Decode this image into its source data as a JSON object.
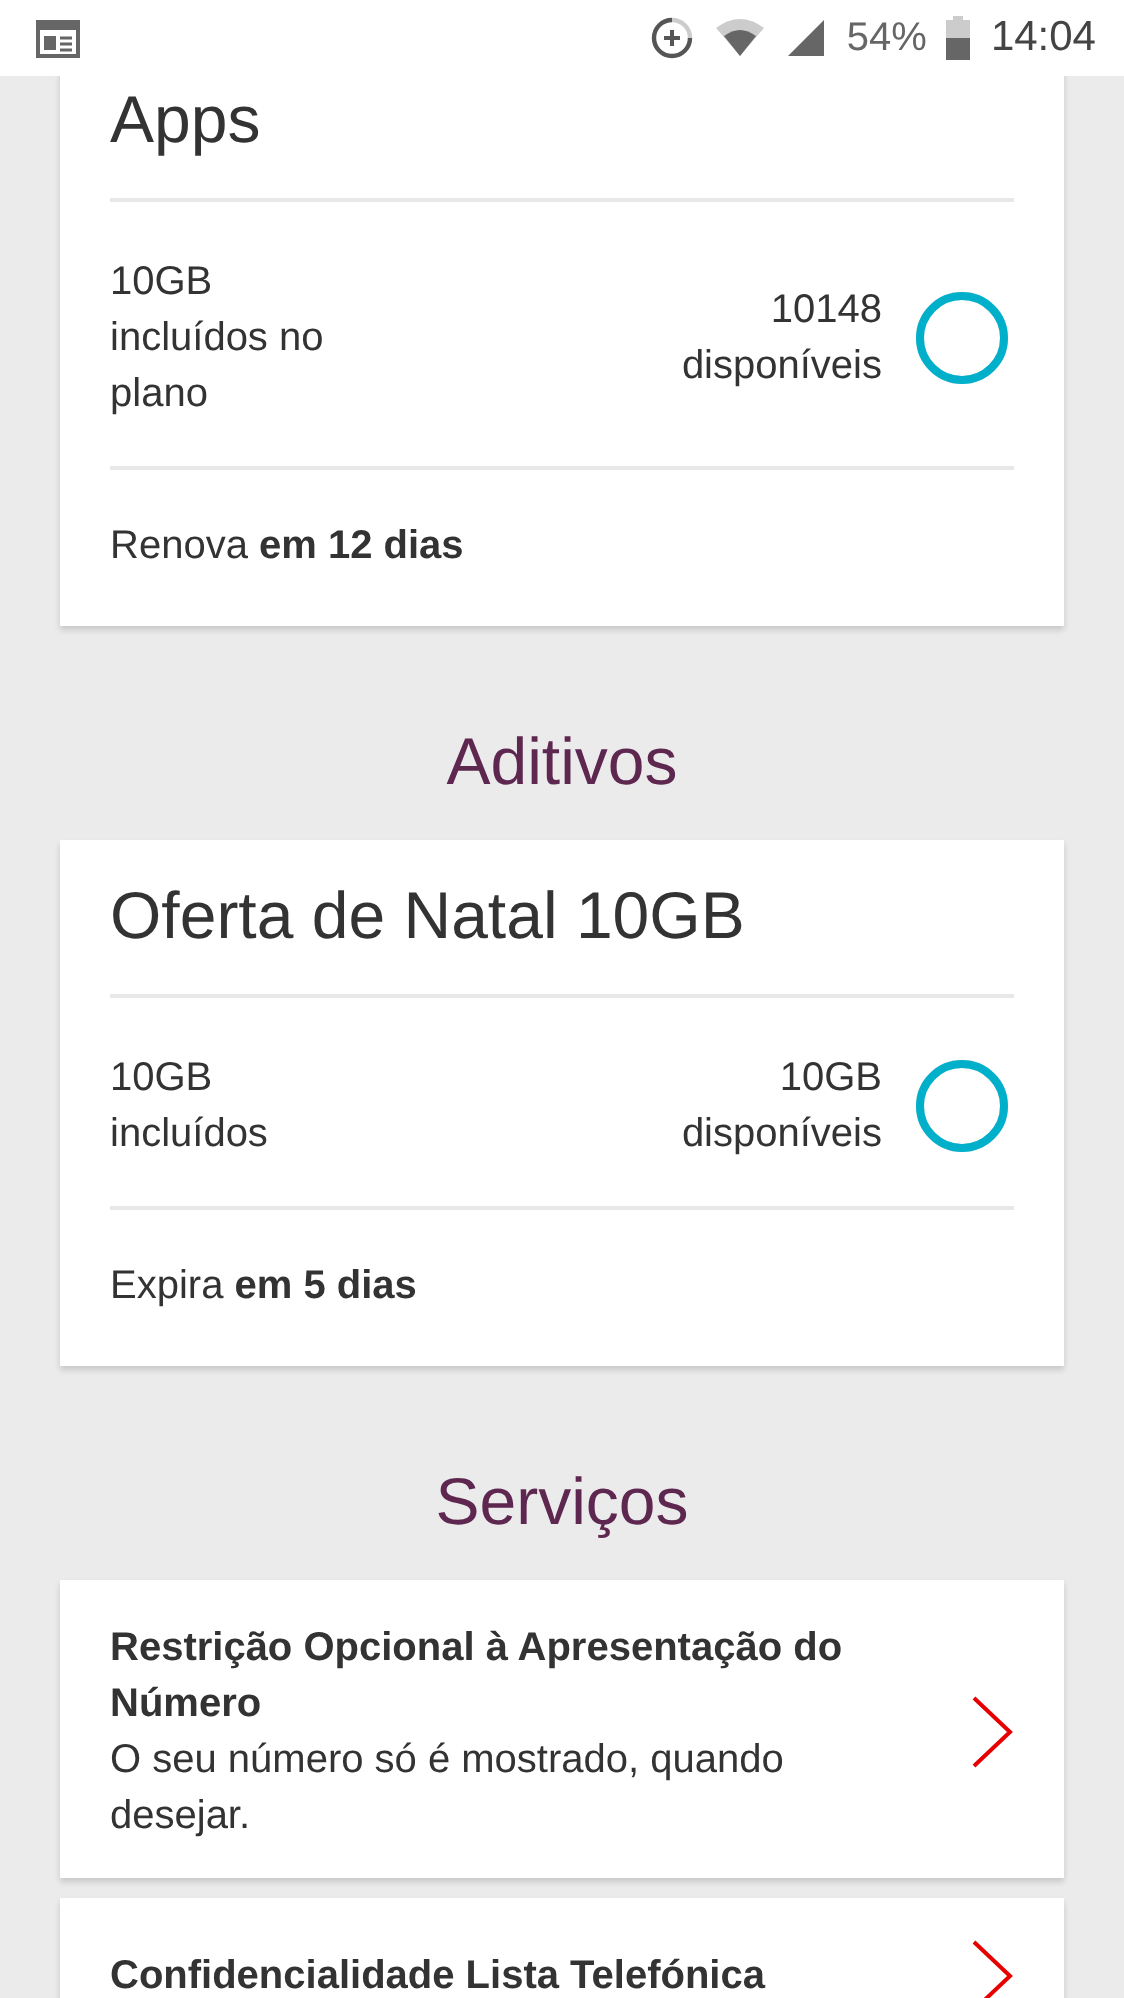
{
  "status_bar": {
    "battery": "54%",
    "time": "14:04"
  },
  "plans": [
    {
      "title": "Apps",
      "included": "10GB incluídos no plano",
      "available": "10148 disponíveis",
      "level": 1,
      "footer": "Renova **em 12 dias**"
    }
  ],
  "addons_heading": "Aditivos",
  "addons": [
    {
      "title": "Oferta de Natal 10GB",
      "included": "10GB incluídos",
      "available": "10GB disponíveis",
      "level": 1,
      "footer": "Expira **em 5 dias**"
    }
  ],
  "services_heading": "Serviços",
  "services": [
    {
      "title": "Restrição Opcional à Apresentação do Número",
      "description": "O seu número só é mostrado, quando desejar."
    },
    {
      "title": "Confidencialidade Lista Telefónica"
    }
  ]
}
